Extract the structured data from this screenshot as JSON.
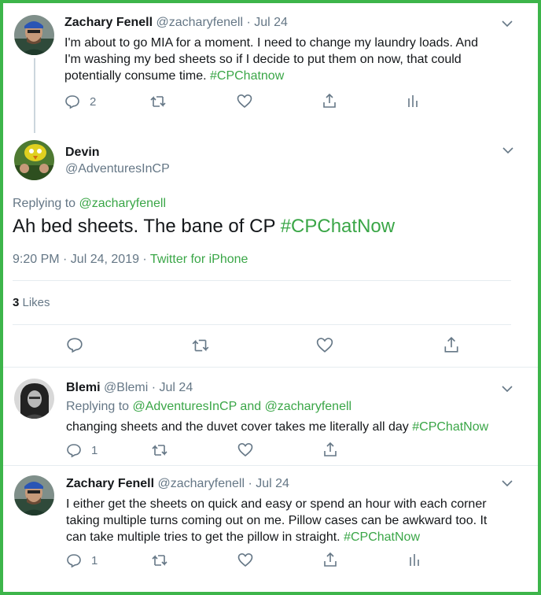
{
  "colors": {
    "accent": "#3aa647",
    "frame": "#3db54a",
    "gray": "#657786"
  },
  "tweet1": {
    "name": "Zachary Fenell",
    "handle": "@zacharyfenell",
    "sep": "·",
    "date": "Jul 24",
    "text_line1": "I'm about to go MIA for a moment. I need to change my laundry loads. And",
    "text_line2": "I'm washing my bed sheets so if I decide to put them on now, that could",
    "text_line3": "potentially consume time. ",
    "hashtag": "#CPChatnow",
    "reply_count": "2"
  },
  "main": {
    "name": "Devin",
    "handle": "@AdventuresInCP",
    "replying_prefix": "Replying to ",
    "replying_to": "@zacharyfenell",
    "text": "Ah bed sheets. The bane of CP ",
    "hashtag": "#CPChatNow",
    "timestamp": "9:20 PM · Jul 24, 2019 · ",
    "source": "Twitter for iPhone",
    "likes_count": "3",
    "likes_label": " Likes"
  },
  "tweet2": {
    "name": "Blemi",
    "handle": "@Blemi",
    "sep": "·",
    "date": "Jul 24",
    "replying_prefix": "Replying to ",
    "replying_to_1": "@AdventuresInCP",
    "replying_and": " and ",
    "replying_to_2": "@zacharyfenell",
    "text": "changing sheets and the duvet cover takes me literally all day ",
    "hashtag": "#CPChatNow",
    "reply_count": "1"
  },
  "tweet3": {
    "name": "Zachary Fenell",
    "handle": "@zacharyfenell",
    "sep": "·",
    "date": "Jul 24",
    "text_line1": "I either get the sheets on quick and easy or spend an hour with each corner",
    "text_line2": "taking multiple turns coming out on me. Pillow cases can be awkward too. It",
    "text_line3": "can take multiple tries to get the pillow in straight. ",
    "hashtag": "#CPChatNow",
    "reply_count": "1"
  }
}
